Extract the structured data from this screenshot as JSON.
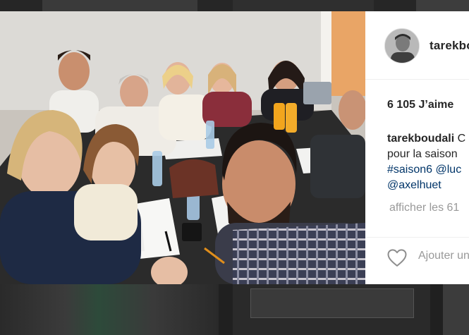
{
  "post": {
    "username": "tarekboudali",
    "likes": "6 105 J’aime",
    "caption": {
      "user": "tarekboudali",
      "text_line1": " C",
      "text_line2": "pour la saison",
      "tag_line3": "#saison6 @luc",
      "tag_line4": "@axelhuet"
    },
    "more_comments": "afficher les 61",
    "comment_placeholder": "Ajouter un"
  },
  "colors": {
    "hashtag": "#003569",
    "muted": "#999999",
    "text": "#262626"
  },
  "icons": {
    "like": "heart-icon"
  }
}
